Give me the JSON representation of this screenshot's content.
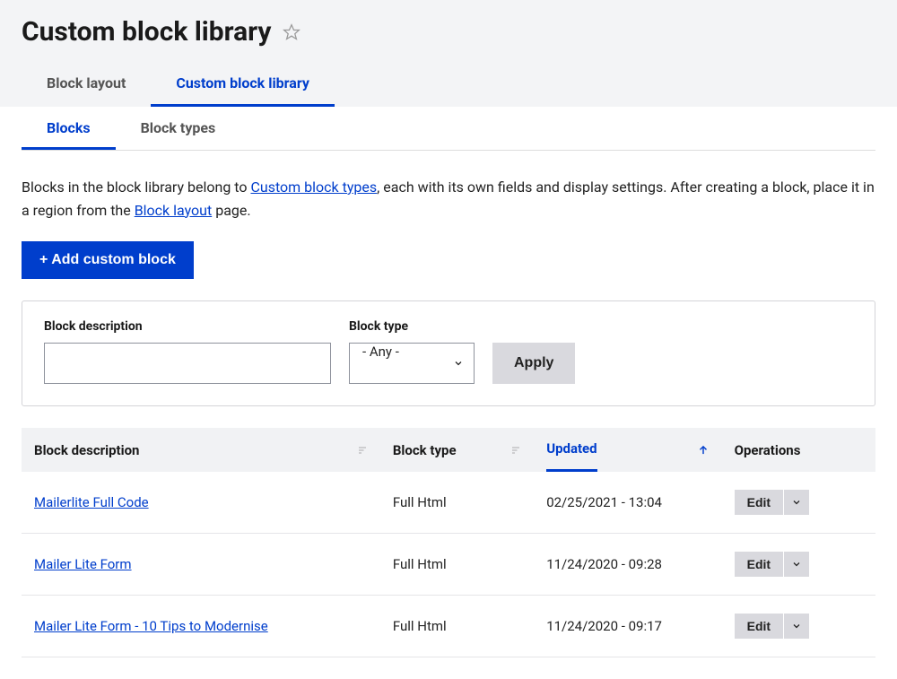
{
  "header": {
    "title": "Custom block library",
    "tabs": [
      {
        "label": "Block layout",
        "active": false
      },
      {
        "label": "Custom block library",
        "active": true
      }
    ]
  },
  "subtabs": [
    {
      "label": "Blocks",
      "active": true
    },
    {
      "label": "Block types",
      "active": false
    }
  ],
  "description": {
    "part1": "Blocks in the block library belong to ",
    "link1": "Custom block types",
    "part2": ", each with its own fields and display settings. After creating a block, place it in a region from the ",
    "link2": "Block layout",
    "part3": " page."
  },
  "add_button": "+ Add custom block",
  "filters": {
    "description_label": "Block description",
    "description_value": "",
    "type_label": "Block type",
    "type_value": "- Any -",
    "apply": "Apply"
  },
  "table": {
    "columns": {
      "description": "Block description",
      "type": "Block type",
      "updated": "Updated",
      "operations": "Operations"
    },
    "sort_column": "updated",
    "sort_dir": "asc",
    "edit_label": "Edit",
    "rows": [
      {
        "description": "Mailerlite Full Code",
        "type": "Full Html",
        "updated": "02/25/2021 - 13:04"
      },
      {
        "description": "Mailer Lite Form",
        "type": "Full Html",
        "updated": "11/24/2020 - 09:28"
      },
      {
        "description": "Mailer Lite Form - 10 Tips to Modernise",
        "type": "Full Html",
        "updated": "11/24/2020 - 09:17"
      }
    ]
  }
}
